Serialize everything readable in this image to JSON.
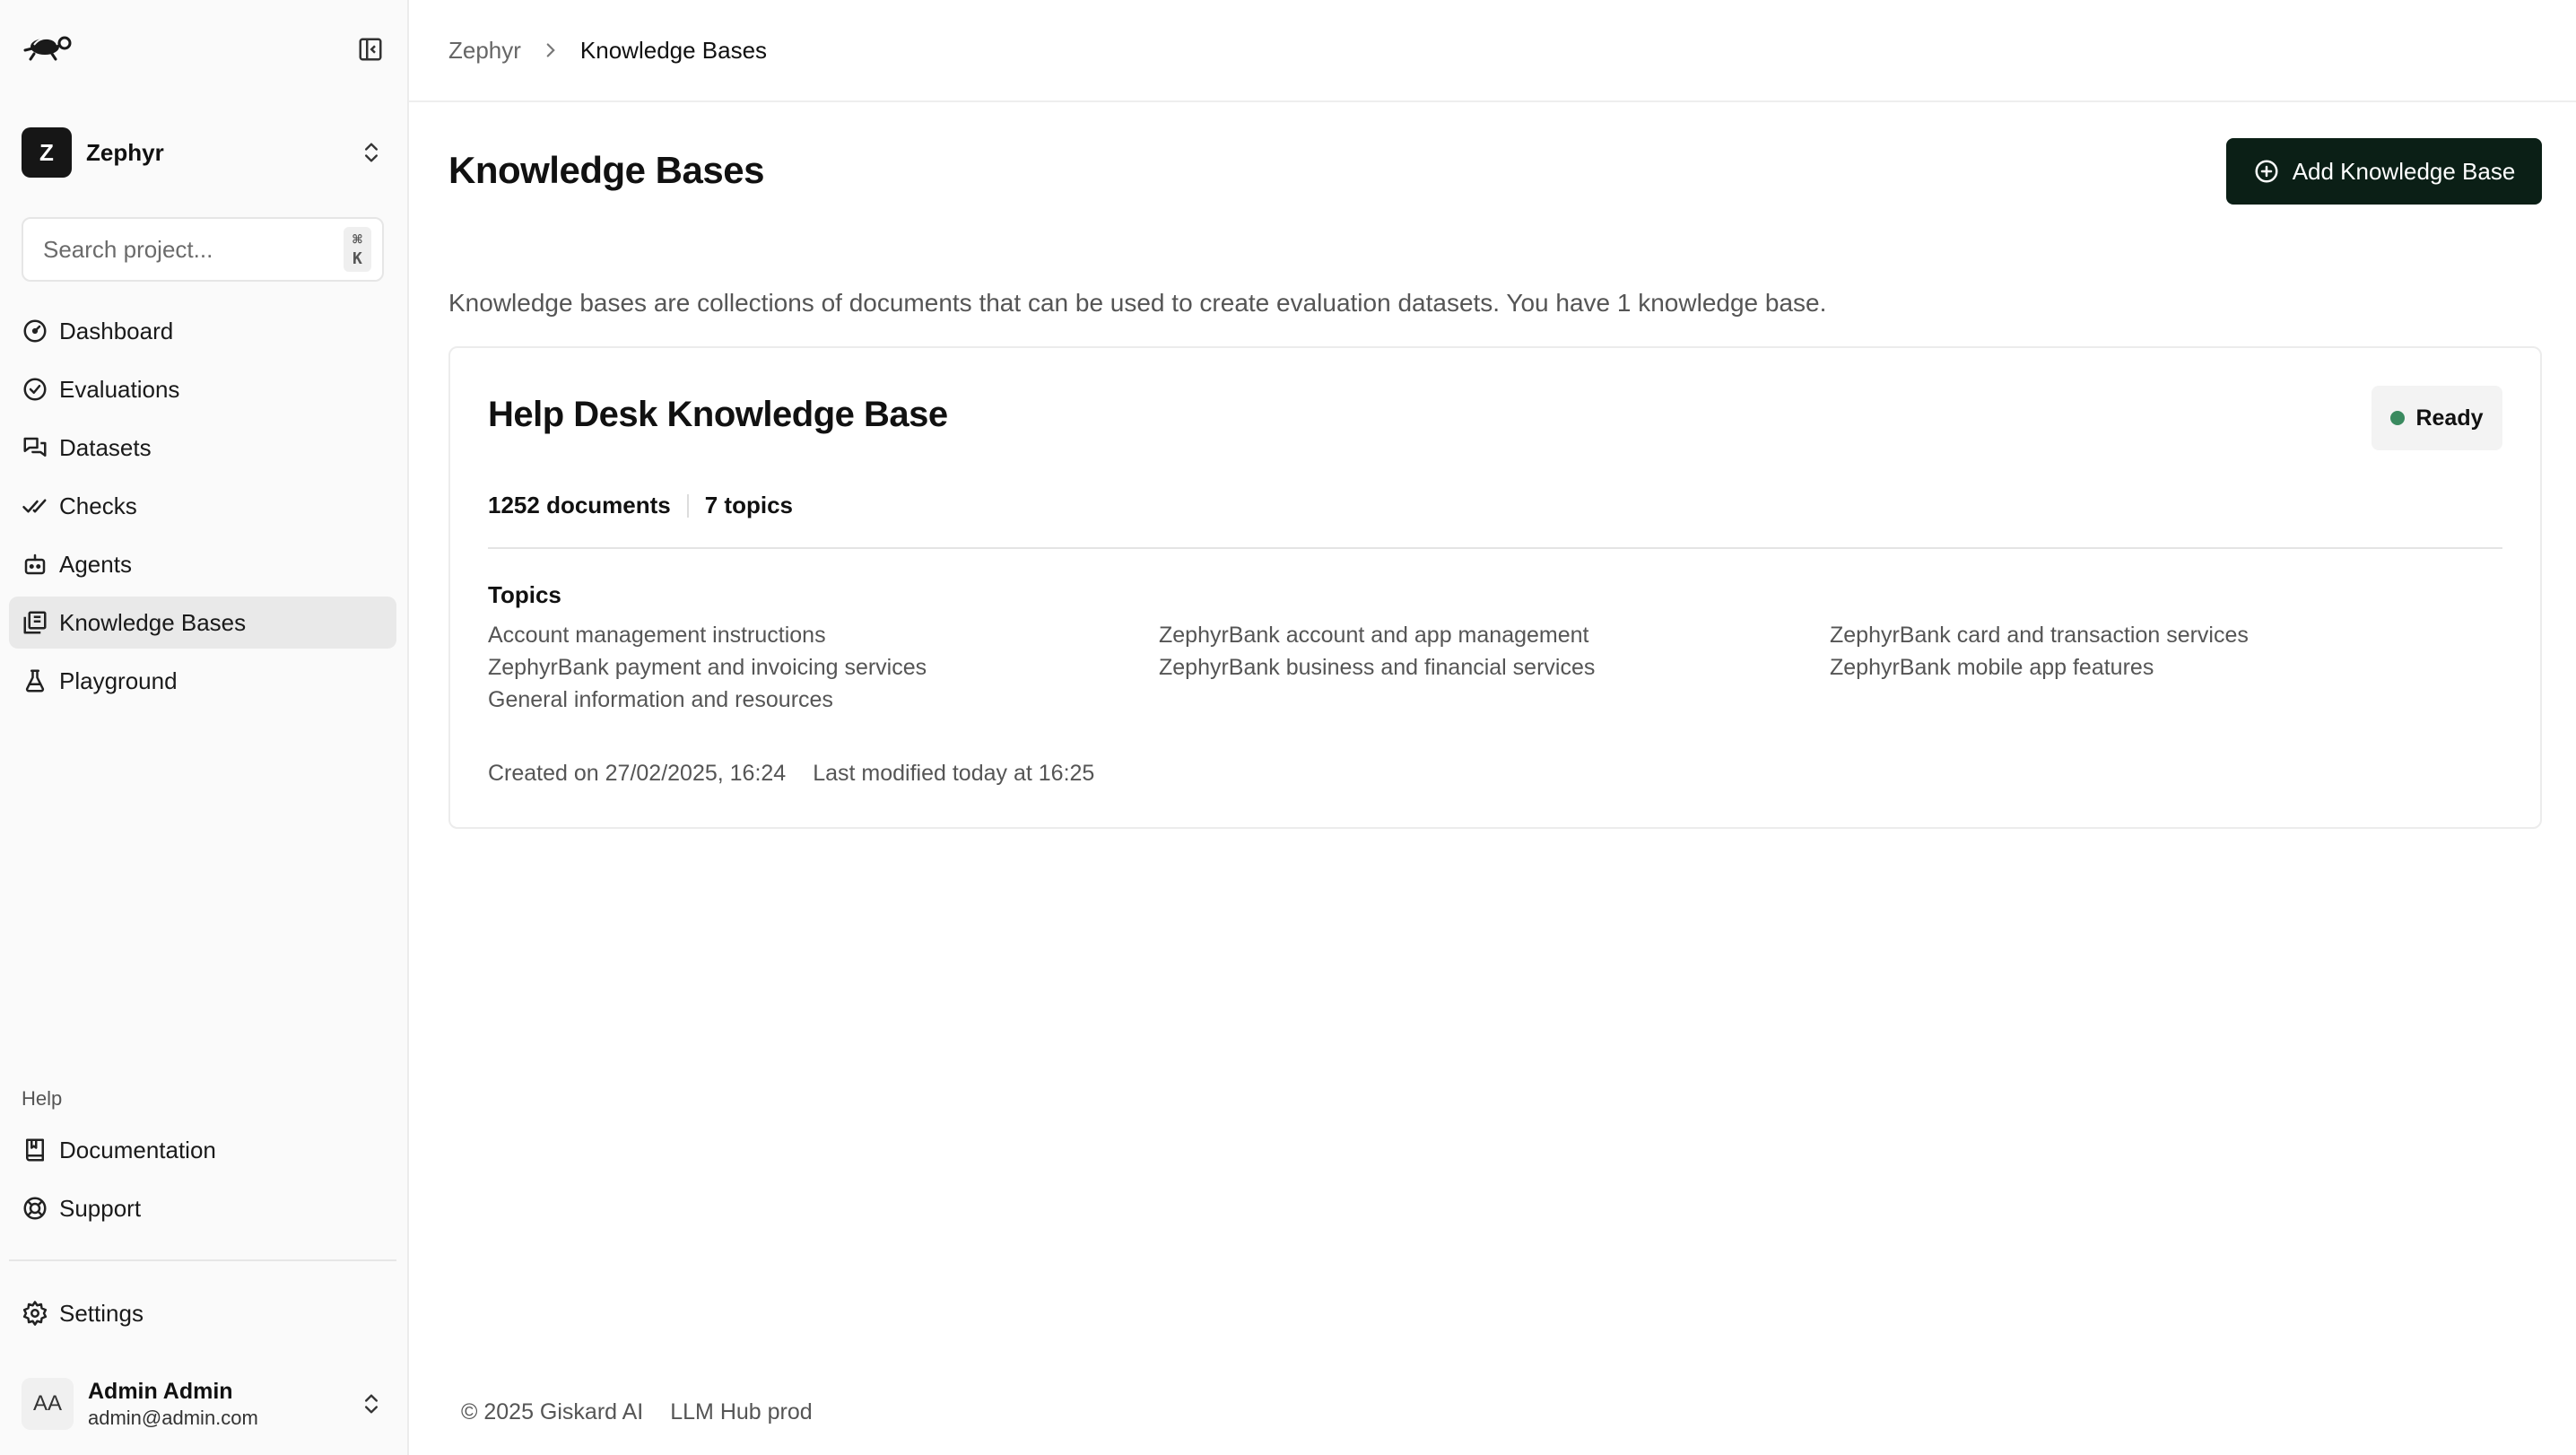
{
  "sidebar": {
    "project": {
      "initial": "Z",
      "name": "Zephyr"
    },
    "search": {
      "placeholder": "Search project...",
      "shortcut": "⌘ K"
    },
    "nav": [
      {
        "label": "Dashboard",
        "icon": "dashboard-icon",
        "active": false
      },
      {
        "label": "Evaluations",
        "icon": "check-circle-icon",
        "active": false
      },
      {
        "label": "Datasets",
        "icon": "messages-icon",
        "active": false
      },
      {
        "label": "Checks",
        "icon": "double-check-icon",
        "active": false
      },
      {
        "label": "Agents",
        "icon": "bot-icon",
        "active": false
      },
      {
        "label": "Knowledge Bases",
        "icon": "library-icon",
        "active": true
      },
      {
        "label": "Playground",
        "icon": "flask-icon",
        "active": false
      }
    ],
    "help_label": "Help",
    "help_items": [
      {
        "label": "Documentation",
        "icon": "book-icon"
      },
      {
        "label": "Support",
        "icon": "lifebuoy-icon"
      }
    ],
    "settings": {
      "label": "Settings",
      "icon": "gear-icon"
    },
    "user": {
      "initials": "AA",
      "name": "Admin Admin",
      "email": "admin@admin.com"
    }
  },
  "breadcrumb": {
    "root": "Zephyr",
    "current": "Knowledge Bases"
  },
  "page": {
    "title": "Knowledge Bases",
    "add_button": "Add Knowledge Base",
    "intro": "Knowledge bases are collections of documents that can be used to create evaluation datasets. You have 1 knowledge base."
  },
  "knowledge_base": {
    "name": "Help Desk Knowledge Base",
    "status": "Ready",
    "status_color": "#3a8a5f",
    "documents": "1252 documents",
    "topics_count": "7 topics",
    "topics_label": "Topics",
    "topics": [
      "Account management instructions",
      "ZephyrBank account and app management",
      "ZephyrBank card and transaction services",
      "ZephyrBank payment and invoicing services",
      "ZephyrBank business and financial services",
      "ZephyrBank mobile app features",
      "General information and resources"
    ],
    "created": "Created on 27/02/2025, 16:24",
    "modified": "Last modified today at 16:25"
  },
  "footer": {
    "copyright": "© 2025 Giskard AI",
    "env": "LLM Hub prod"
  },
  "colors": {
    "primary_button": "#0b1f16",
    "active_nav": "#e9e9e9",
    "sidebar_bg": "#fafafa"
  }
}
